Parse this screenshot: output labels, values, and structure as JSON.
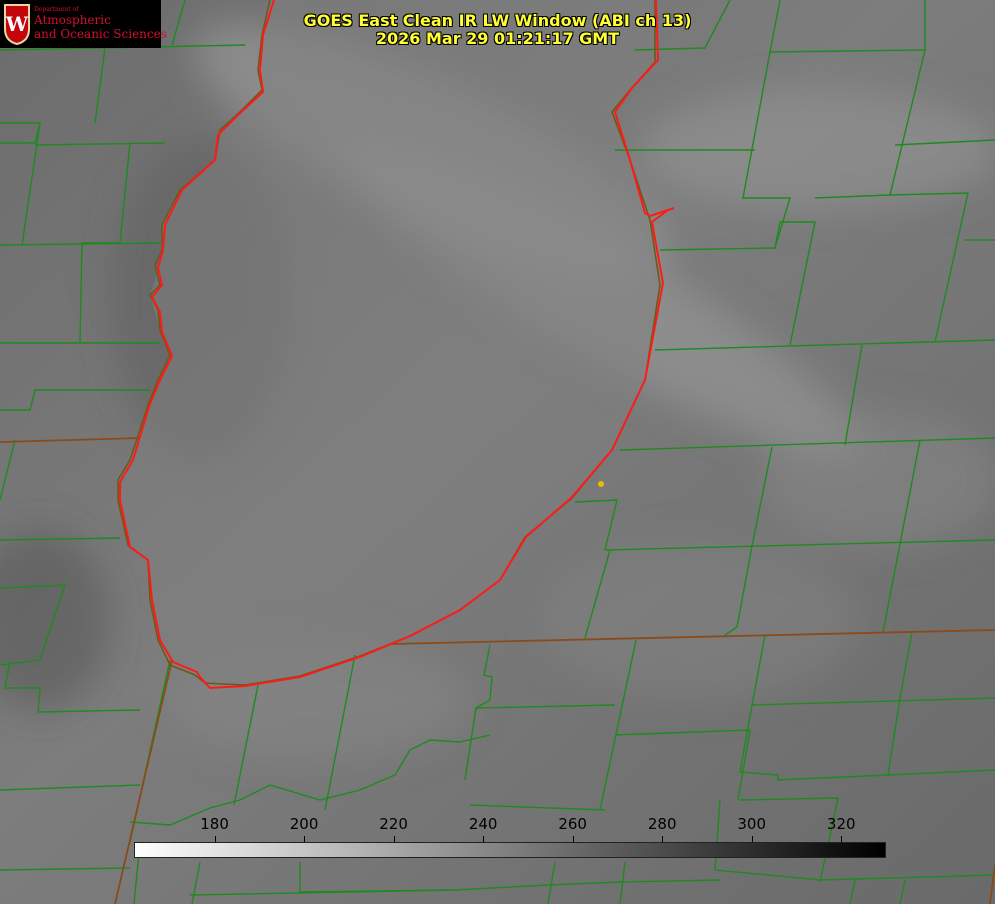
{
  "title": {
    "line1": "GOES East Clean IR LW Window (ABI ch 13)",
    "line2": "2026 Mar 29 01:21:17 GMT"
  },
  "logo": {
    "crest_letter": "W",
    "department_label": "Department of",
    "name_line1": "Atmospheric",
    "name_line2": "and Oceanic Sciences",
    "color": "#d4102c"
  },
  "colorbar": {
    "unit_min": 162,
    "unit_max": 330,
    "ticks": [
      "180",
      "200",
      "220",
      "240",
      "260",
      "280",
      "300",
      "320"
    ],
    "color_low": "#ffffff",
    "color_high": "#000000"
  },
  "map": {
    "lake_outline_color": "#ff1a1a",
    "county_line_color": "#1f8a1f",
    "state_line_color": "#8a4a1a",
    "marker_color": "#e6c000"
  }
}
